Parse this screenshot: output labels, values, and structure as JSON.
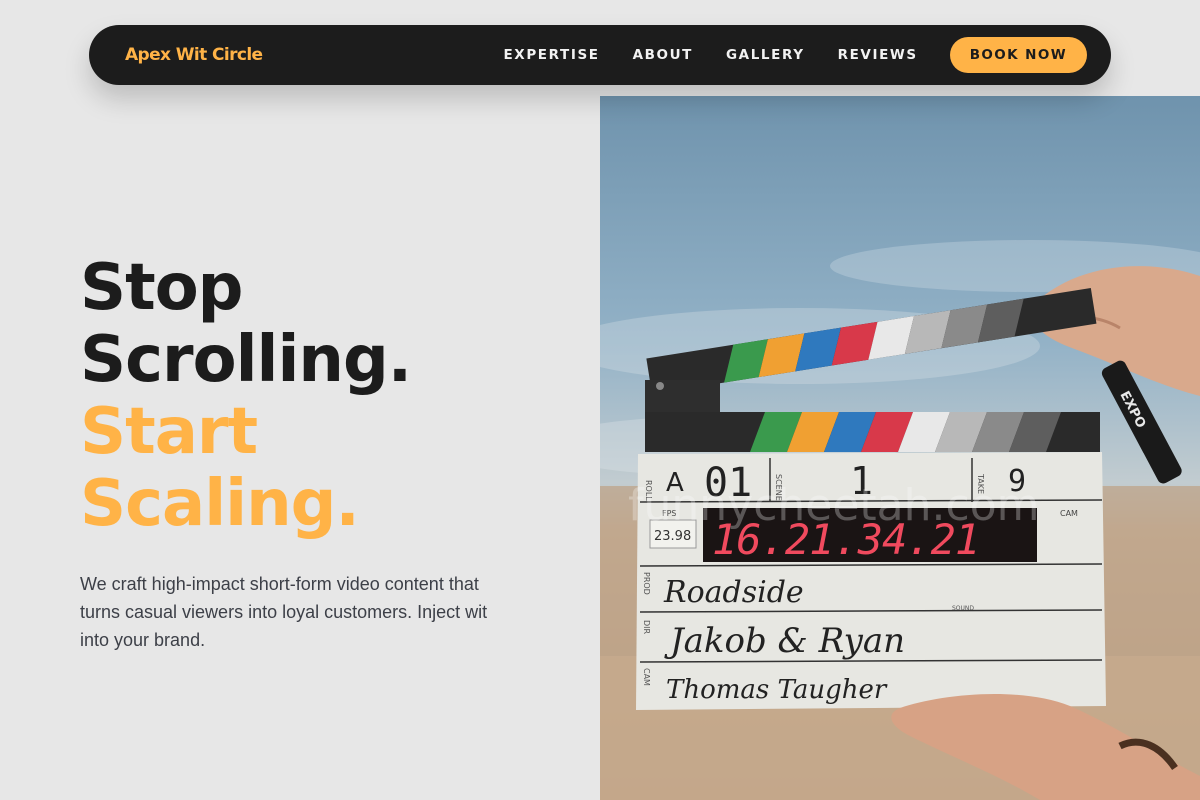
{
  "brand": {
    "name": "Apex Wit Circle",
    "color": "#ffb347"
  },
  "nav": {
    "links": [
      "EXPERTISE",
      "ABOUT",
      "GALLERY",
      "REVIEWS"
    ],
    "cta_label": "BOOK NOW"
  },
  "hero": {
    "headline_dark": [
      "Stop",
      "Scrolling."
    ],
    "headline_accent": [
      "Start",
      "Scaling."
    ],
    "subtext": "We craft high-impact short-form video content that turns casual viewers into loyal customers. Inject wit into your brand."
  },
  "photo": {
    "icon": "clapperboard-photo",
    "slate": {
      "roll_label": "ROLL",
      "roll": "A",
      "scene_label": "SCENE",
      "scene": "01",
      "take_label": "TAKE",
      "take": "9",
      "shot": "1",
      "fps_label": "FPS",
      "fps": "23.98",
      "timecode": "16.21.34.21",
      "cam_label": "CAM",
      "prod_label": "PROD",
      "prod": "Roadside",
      "dir_label": "DIR",
      "dir": "Jakob & Ryan",
      "cam_row_label": "CAM",
      "cam": "Thomas Taugher",
      "sound_label": "SOUND",
      "marker": "EXPO"
    },
    "watermark": "funnycheetah.com"
  },
  "colors": {
    "accent": "#ffb347",
    "nav_bg": "#1c1c1c",
    "page_bg": "#e7e7e7"
  }
}
